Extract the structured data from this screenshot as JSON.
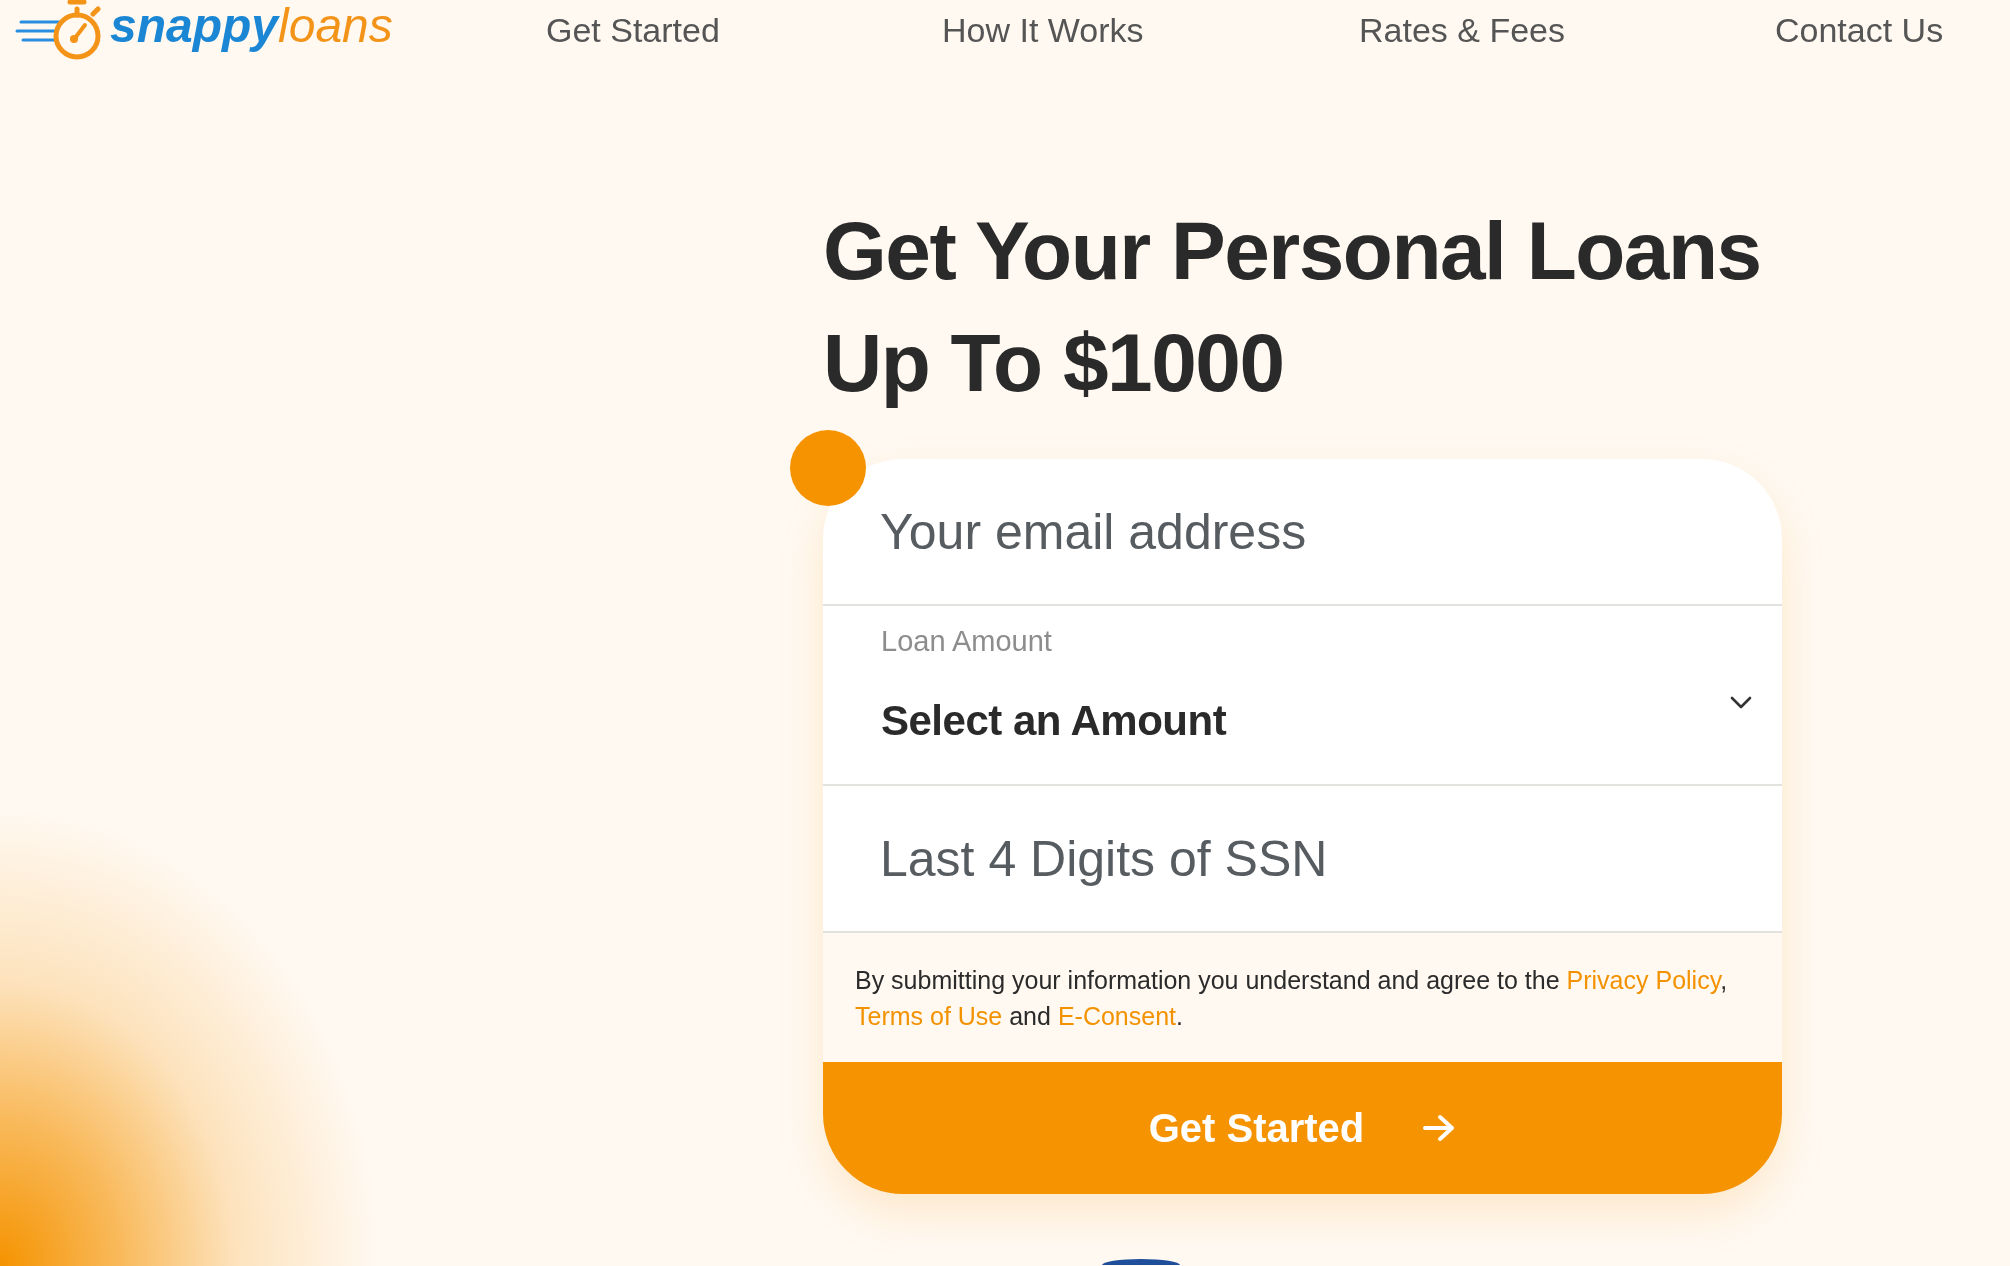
{
  "header": {
    "logo": {
      "parts": [
        {
          "kind": "primary",
          "text": "snappy"
        },
        {
          "kind": "accent",
          "text": "loans"
        }
      ]
    },
    "nav": [
      {
        "label": "Get Started"
      },
      {
        "label": "How It Works"
      },
      {
        "label": "Rates & Fees"
      },
      {
        "label": "Contact Us"
      }
    ]
  },
  "hero": {
    "title": "Get Your Personal Loans Up To $1000"
  },
  "form": {
    "fields": [
      {
        "kind": "text",
        "placeholder": "Your email address"
      },
      {
        "kind": "select",
        "label": "Loan Amount",
        "value": "Select an Amount"
      },
      {
        "kind": "text",
        "placeholder": "Last 4 Digits of SSN"
      }
    ],
    "consent": [
      {
        "kind": "text",
        "text": "By submitting your information you understand and agree to the "
      },
      {
        "kind": "link",
        "text": "Privacy Policy"
      },
      {
        "kind": "text",
        "text": ", "
      },
      {
        "kind": "link",
        "text": "Terms of Use"
      },
      {
        "kind": "text",
        "text": " and "
      },
      {
        "kind": "link",
        "text": "E-Consent"
      },
      {
        "kind": "text",
        "text": "."
      }
    ],
    "submit": {
      "label": "Get Started"
    }
  }
}
